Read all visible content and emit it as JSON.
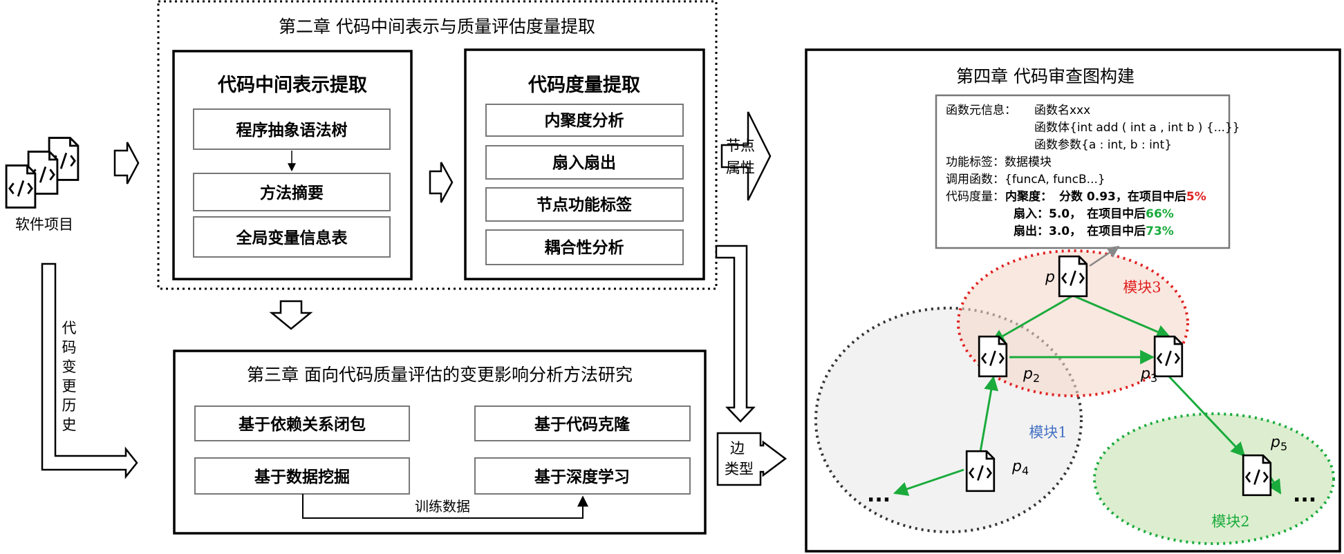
{
  "software": {
    "label": "软件项目"
  },
  "change_history": {
    "label": "代码变更历史"
  },
  "chapter2": {
    "title": "第二章  代码中间表示与质量评估度量提取",
    "ir": {
      "title": "代码中间表示提取",
      "items": [
        "程序抽象语法树",
        "方法摘要",
        "全局变量信息表"
      ]
    },
    "metrics": {
      "title": "代码度量提取",
      "items": [
        "内聚度分析",
        "扇入扇出",
        "节点功能标签",
        "耦合性分析"
      ]
    }
  },
  "node_attr_label": "节点属性",
  "edge_type_label": "边类型",
  "chapter3": {
    "title": "第三章  面向代码质量评估的变更影响分析方法研究",
    "methods": [
      "基于依赖关系闭包",
      "基于代码克隆",
      "基于数据挖掘",
      "基于深度学习"
    ],
    "training_label": "训练数据"
  },
  "chapter4": {
    "title": "第四章  代码审查图构建",
    "info": {
      "meta_label": "函数元信息：",
      "name_line": "函数名xxx",
      "body_line": "函数体{int add ( int a , int b ) {...}}",
      "param_line": "函数参数{a : int, b : int}",
      "func_label_line": "功能标签：数据模块",
      "call_line": "调用函数：{funcA, funcB...}",
      "metric_label": "代码度量：",
      "cohesion_label": "内聚度：",
      "cohesion_score_text": "分数 0.93，",
      "cohesion_rank_text": "在项目中后",
      "cohesion_pct": "5%",
      "fanin_label": "扇入：",
      "fanin_value": "5.0，",
      "fanin_rank_text": "在项目中后",
      "fanin_pct": "66%",
      "fanout_label": "扇出：",
      "fanout_value": "3.0，",
      "fanout_rank_text": "在项目中后",
      "fanout_pct": "73%"
    },
    "modules": [
      {
        "label": "模块3",
        "color": "#e02020"
      },
      {
        "label": "模块1",
        "color": "#4472c4"
      },
      {
        "label": "模块2",
        "color": "#1aab3c"
      }
    ],
    "nodes": [
      {
        "label": "p"
      },
      {
        "label": "p",
        "sub": "2"
      },
      {
        "label": "p",
        "sub": "3"
      },
      {
        "label": "p",
        "sub": "4"
      },
      {
        "label": "p",
        "sub": "5"
      }
    ],
    "ellipsis": "..."
  },
  "colors": {
    "green_arrow": "#1aab3c",
    "red_pct": "#e02020",
    "green_pct": "#1aab3c",
    "gray_arrow": "#888888"
  }
}
